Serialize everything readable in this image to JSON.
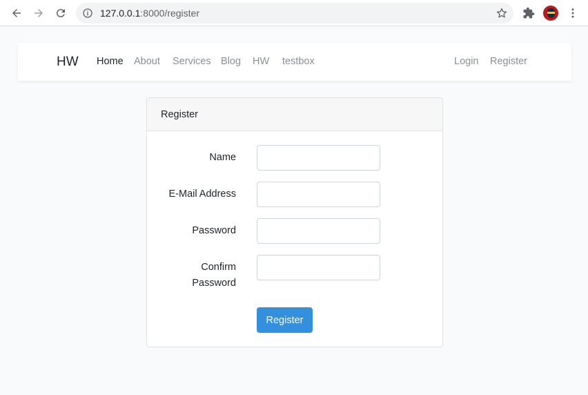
{
  "browser": {
    "url_host": "127.0.0.1",
    "url_rest": ":8000/register"
  },
  "navbar": {
    "brand": "HW",
    "links": [
      "Home",
      "About",
      "Services",
      "Blog",
      "HW",
      "testbox"
    ],
    "auth_links": [
      "Login",
      "Register"
    ]
  },
  "card": {
    "header": "Register",
    "fields": [
      {
        "label": "Name",
        "value": ""
      },
      {
        "label": "E-Mail Address",
        "value": ""
      },
      {
        "label": "Password",
        "value": ""
      },
      {
        "label_line1": "Confirm",
        "label_line2": "Password",
        "value": ""
      }
    ],
    "submit_label": "Register"
  },
  "colors": {
    "primary": "#3490dc",
    "page_background": "#f8fafc"
  }
}
